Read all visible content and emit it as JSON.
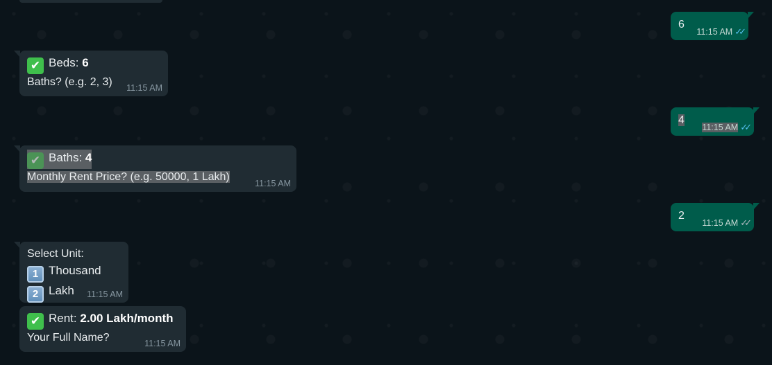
{
  "messages": {
    "out_1": {
      "text": "6",
      "time": "11:15 AM"
    },
    "in_1": {
      "check": "✔",
      "line1_label": "Beds: ",
      "line1_value": "6",
      "line2": "Baths? (e.g. 2, 3)",
      "time": "11:15 AM"
    },
    "out_2": {
      "text": "4",
      "time": "11:15 AM"
    },
    "in_2": {
      "check": "✔",
      "line1_label": "Baths: ",
      "line1_value": "4",
      "line2": "Monthly Rent Price? (e.g. 50000, 1 Lakh)",
      "time": "11:15 AM"
    },
    "out_3": {
      "text": "2",
      "time": "11:15 AM"
    },
    "in_3": {
      "line1": "Select Unit:",
      "key1": "1",
      "opt1": "Thousand",
      "key2": "2",
      "opt2": "Lakh",
      "time": "11:15 AM"
    },
    "in_4": {
      "check": "✔",
      "line1_label": "Rent: ",
      "line1_value": "2.00 Lakh/month",
      "line2": "Your Full Name?",
      "time": "11:15 AM"
    }
  },
  "icons": {
    "read_receipt": "double-check-icon",
    "check_emoji": "check-mark-button-icon",
    "keycap": "keycap-digit-icon"
  },
  "colors": {
    "background": "#0b141a",
    "incoming_bubble": "#202c33",
    "outgoing_bubble": "#005c4b",
    "read_ticks": "#53bdeb"
  }
}
